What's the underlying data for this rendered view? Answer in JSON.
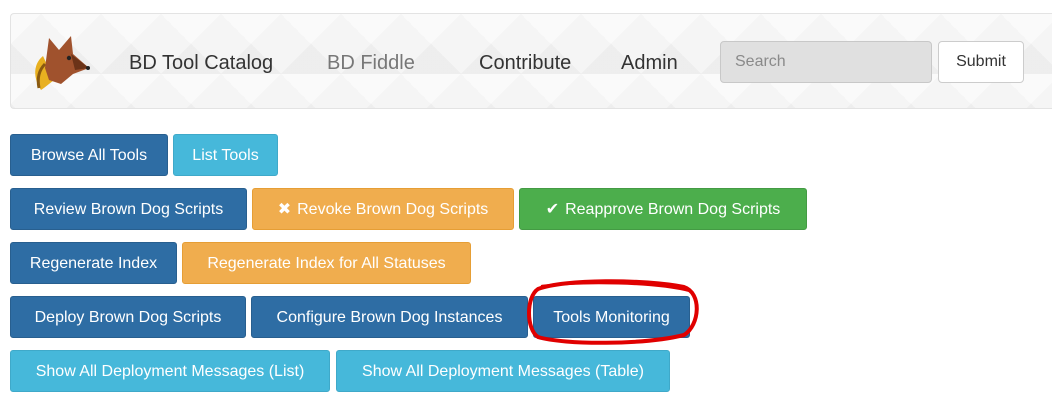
{
  "navbar": {
    "brand_icon": "fox-logo",
    "links": [
      {
        "label": "BD Tool Catalog"
      },
      {
        "label": "BD Fiddle"
      },
      {
        "label": "Contribute"
      },
      {
        "label": "Admin"
      }
    ],
    "search": {
      "placeholder": "Search",
      "value": ""
    },
    "submit_label": "Submit"
  },
  "buttons": {
    "browse_all_tools": "Browse All Tools",
    "list_tools": "List Tools",
    "review_scripts": "Review Brown Dog Scripts",
    "revoke_scripts": "Revoke Brown Dog Scripts",
    "reapprove_scripts": "Reapprove Brown Dog Scripts",
    "regenerate_index": "Regenerate Index",
    "regenerate_index_all": "Regenerate Index for All Statuses",
    "deploy_scripts": "Deploy Brown Dog Scripts",
    "configure_instances": "Configure Brown Dog Instances",
    "tools_monitoring": "Tools Monitoring",
    "show_messages_list": "Show All Deployment Messages (List)",
    "show_messages_table": "Show All Deployment Messages (Table)"
  },
  "icons": {
    "revoke": "x-icon",
    "reapprove": "checkmark-icon"
  },
  "colors": {
    "primary": "#2e6da4",
    "info": "#46b8da",
    "warning": "#f0ad4e",
    "success": "#4cae4c",
    "annotation": "#e00000"
  }
}
